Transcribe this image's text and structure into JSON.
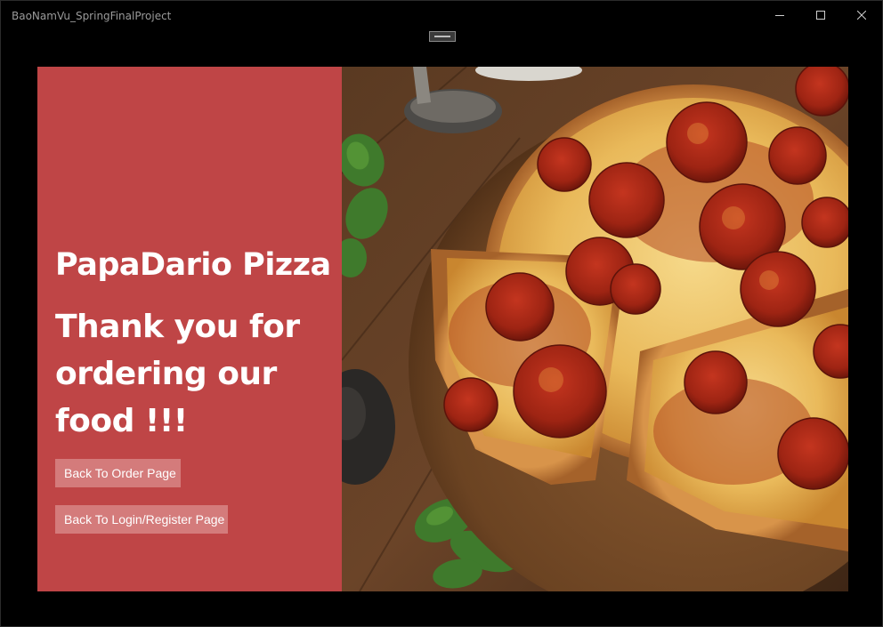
{
  "window": {
    "title": "BaoNamVu_SpringFinalProject",
    "controls": [
      "minimize-icon",
      "maximize-icon",
      "close-icon"
    ]
  },
  "panel": {
    "brand": "PapaDario Pizza",
    "message": "Thank you for ordering our food !!!",
    "background_color": "#bf4546",
    "buttons": {
      "order_label": "Back To Order Page",
      "login_label": "Back To Login/Register Page"
    }
  },
  "image": {
    "subject": "pepperoni-pizza-photo"
  }
}
